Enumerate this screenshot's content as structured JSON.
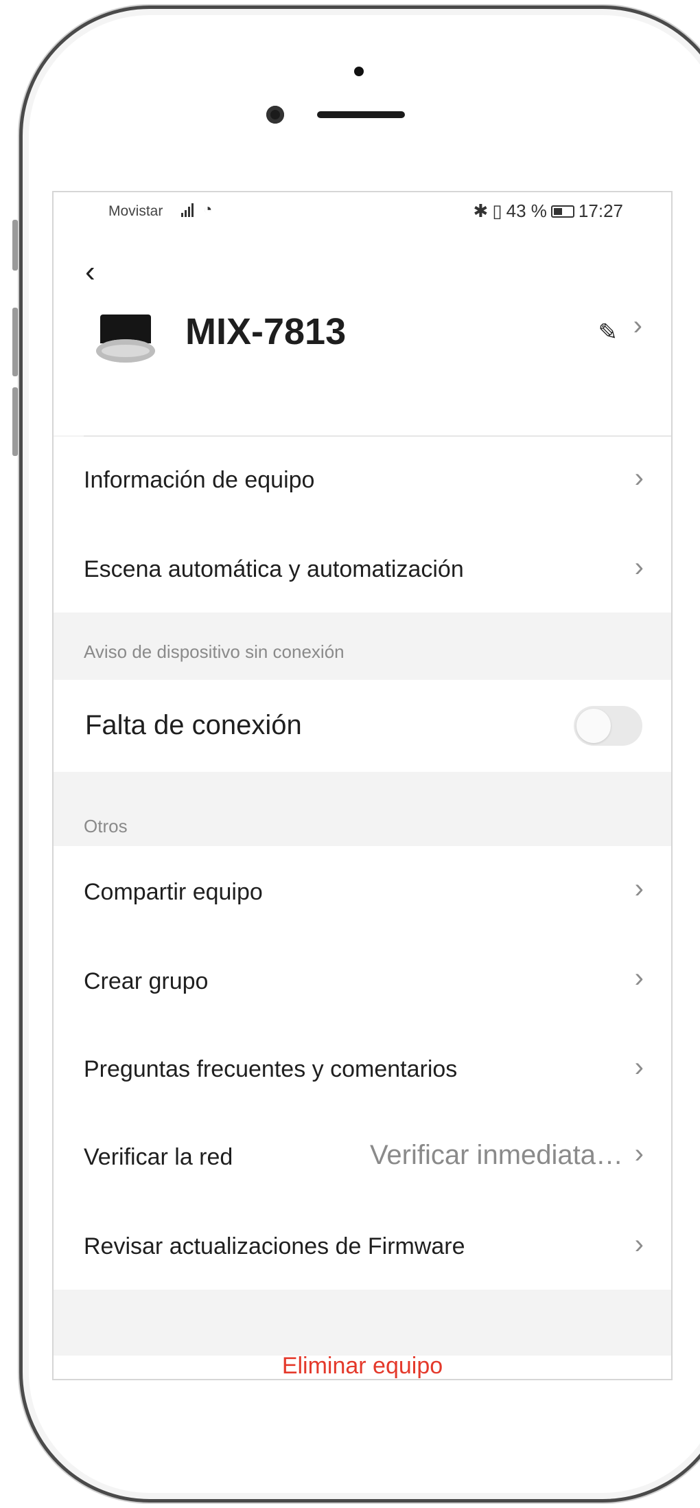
{
  "status_bar": {
    "carrier": "Movistar",
    "battery_percent": "43 %",
    "time": "17:27"
  },
  "header": {
    "device_name": "MIX-7813"
  },
  "menu": {
    "device_info": "Información de equipo",
    "automation": "Escena automática y automatización"
  },
  "offline_section": {
    "title": "Aviso de dispositivo sin conexión",
    "offline_label": "Falta de conexión",
    "offline_enabled": false
  },
  "others_section": {
    "title": "Otros",
    "share": "Compartir equipo",
    "create_group": "Crear grupo",
    "faq": "Preguntas frecuentes y comentarios",
    "verify_network": "Verificar la red",
    "verify_now": "Verificar inmediata…",
    "firmware": "Revisar actualizaciones de Firmware"
  },
  "delete_device": "Eliminar equipo",
  "colors": {
    "danger": "#e4392b",
    "section_bg": "#f3f3f3"
  }
}
